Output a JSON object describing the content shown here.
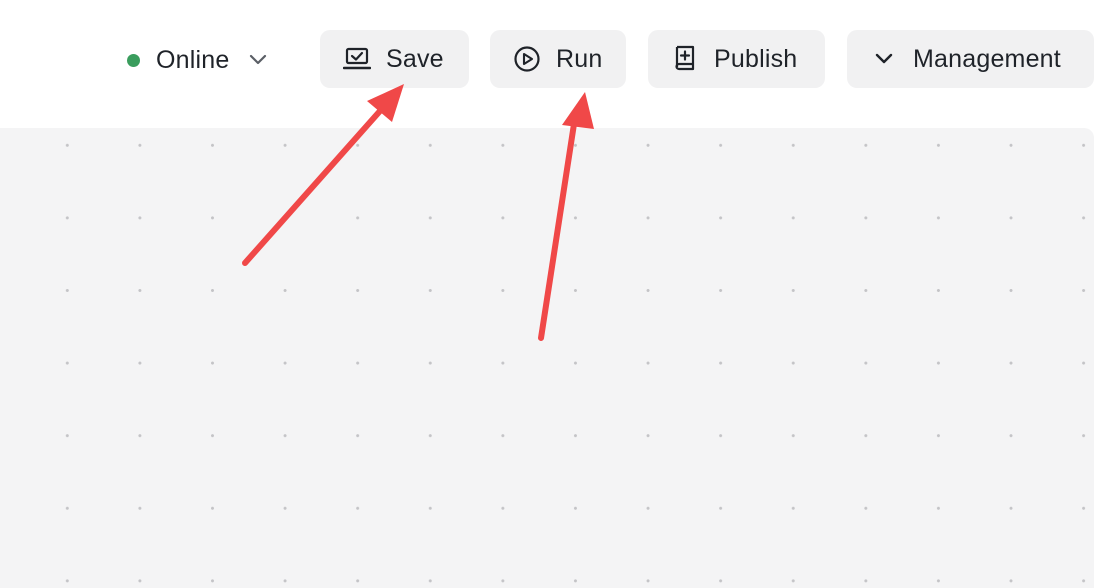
{
  "status": {
    "label": "Online",
    "dot_color": "#3a9d5d",
    "icon": "chevron-down-icon"
  },
  "toolbar": {
    "save_label": "Save",
    "save_icon": "save-laptop-check-icon",
    "run_label": "Run",
    "run_icon": "play-circle-icon",
    "publish_label": "Publish",
    "publish_icon": "publish-book-plus-icon",
    "management_label": "Management",
    "management_icon": "chevron-down-icon"
  },
  "canvas": {
    "background": "#f4f4f5",
    "grid": "dotted"
  },
  "annotations": {
    "arrow_color": "#f04848",
    "arrows": [
      "points to Save button",
      "points to Run button"
    ]
  }
}
